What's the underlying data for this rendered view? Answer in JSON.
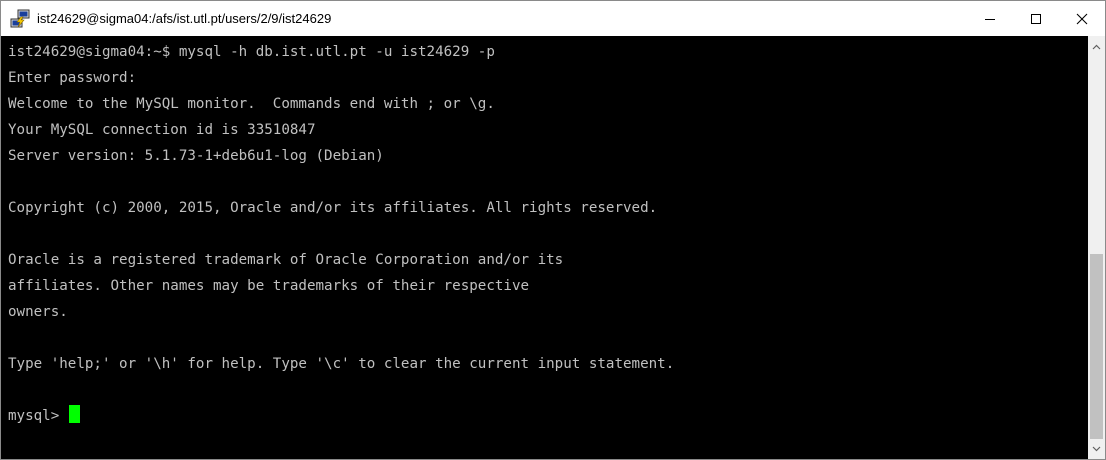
{
  "window": {
    "title": "ist24629@sigma04:/afs/ist.utl.pt/users/2/9/ist24629",
    "app_icon": "putty-icon",
    "controls": [
      "minimize-icon",
      "maximize-icon",
      "close-icon"
    ]
  },
  "terminal": {
    "lines": [
      "ist24629@sigma04:~$ mysql -h db.ist.utl.pt -u ist24629 -p",
      "Enter password:",
      "Welcome to the MySQL monitor.  Commands end with ; or \\g.",
      "Your MySQL connection id is 33510847",
      "Server version: 5.1.73-1+deb6u1-log (Debian)",
      "",
      "Copyright (c) 2000, 2015, Oracle and/or its affiliates. All rights reserved.",
      "",
      "Oracle is a registered trademark of Oracle Corporation and/or its",
      "affiliates. Other names may be trademarks of their respective",
      "owners.",
      "",
      "Type 'help;' or '\\h' for help. Type '\\c' to clear the current input statement.",
      ""
    ],
    "prompt": "mysql> ",
    "colors": {
      "background": "#000000",
      "text": "#c0c0c0",
      "cursor": "#00ff00"
    }
  }
}
